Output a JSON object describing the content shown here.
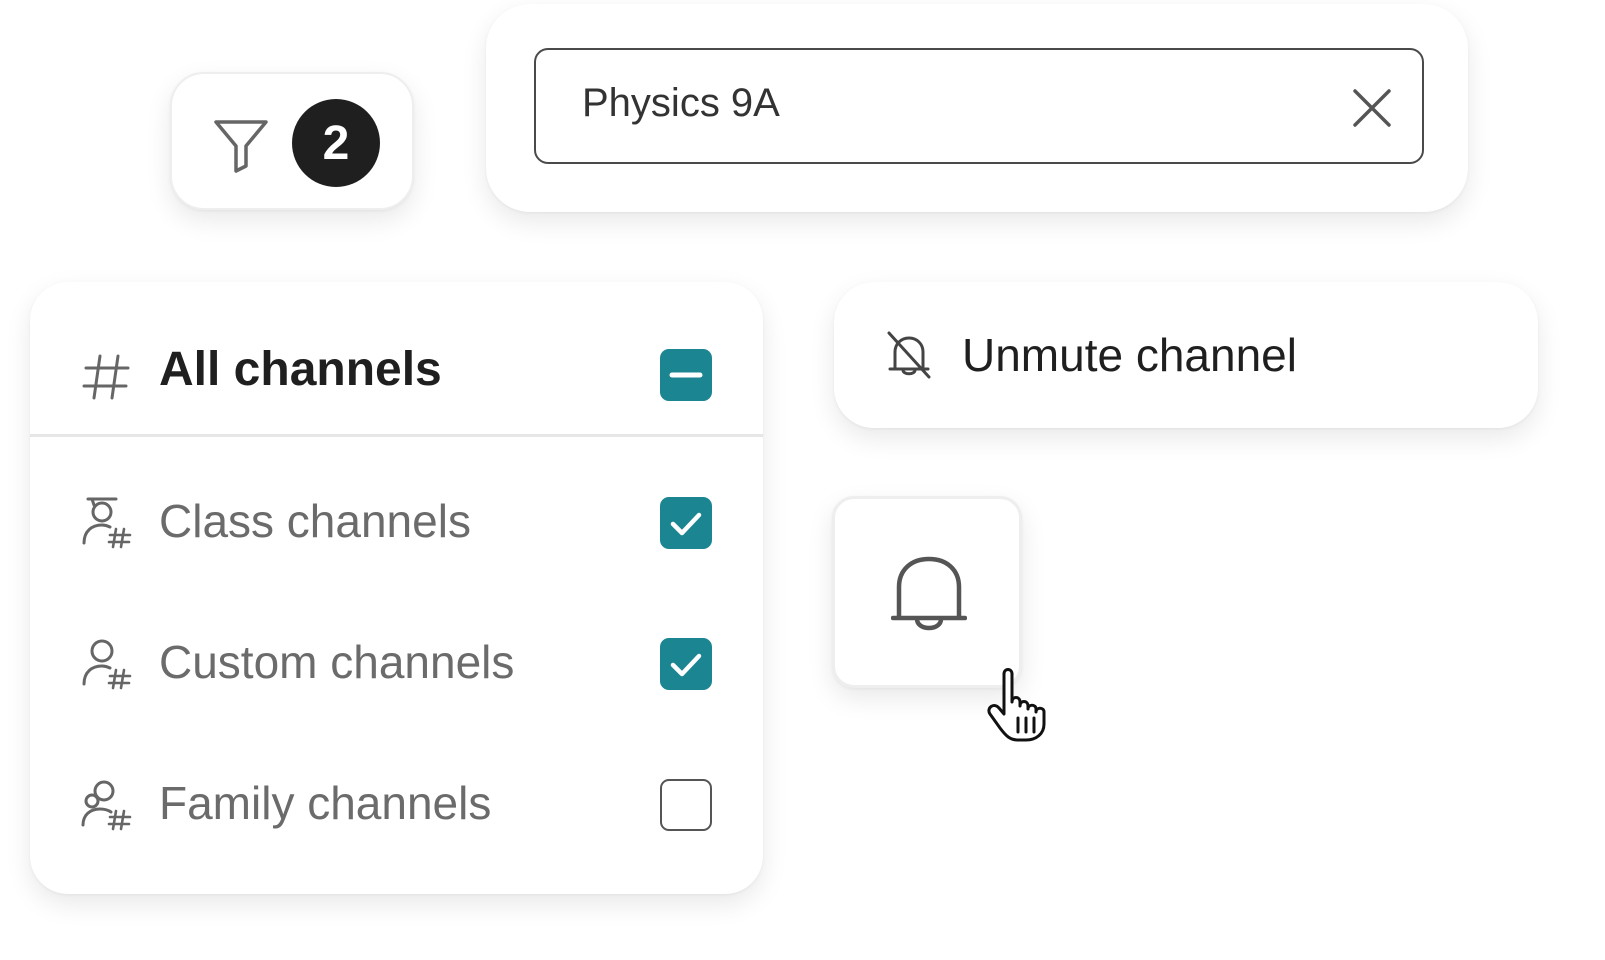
{
  "filter": {
    "icon": "filter-icon",
    "count": "2"
  },
  "search": {
    "value": "Physics 9A",
    "clear_icon": "close-icon"
  },
  "channels": {
    "all": {
      "icon": "hash-icon",
      "label": "All channels",
      "state": "indeterminate"
    },
    "items": [
      {
        "icon": "class-channel-icon",
        "label": "Class channels",
        "checked": true
      },
      {
        "icon": "custom-channel-icon",
        "label": "Custom channels",
        "checked": true
      },
      {
        "icon": "family-channel-icon",
        "label": "Family channels",
        "checked": false
      }
    ]
  },
  "unmute": {
    "icon": "bell-off-icon",
    "label": "Unmute channel"
  },
  "bell_button": {
    "icon": "bell-icon"
  },
  "cursor": {
    "icon": "hand-pointer-icon"
  },
  "colors": {
    "accent": "#1b8592",
    "badge_bg": "#1f1f1f",
    "text_primary": "#1f1f1f",
    "text_secondary": "#6b6b6b",
    "border": "#4a4a4a"
  }
}
